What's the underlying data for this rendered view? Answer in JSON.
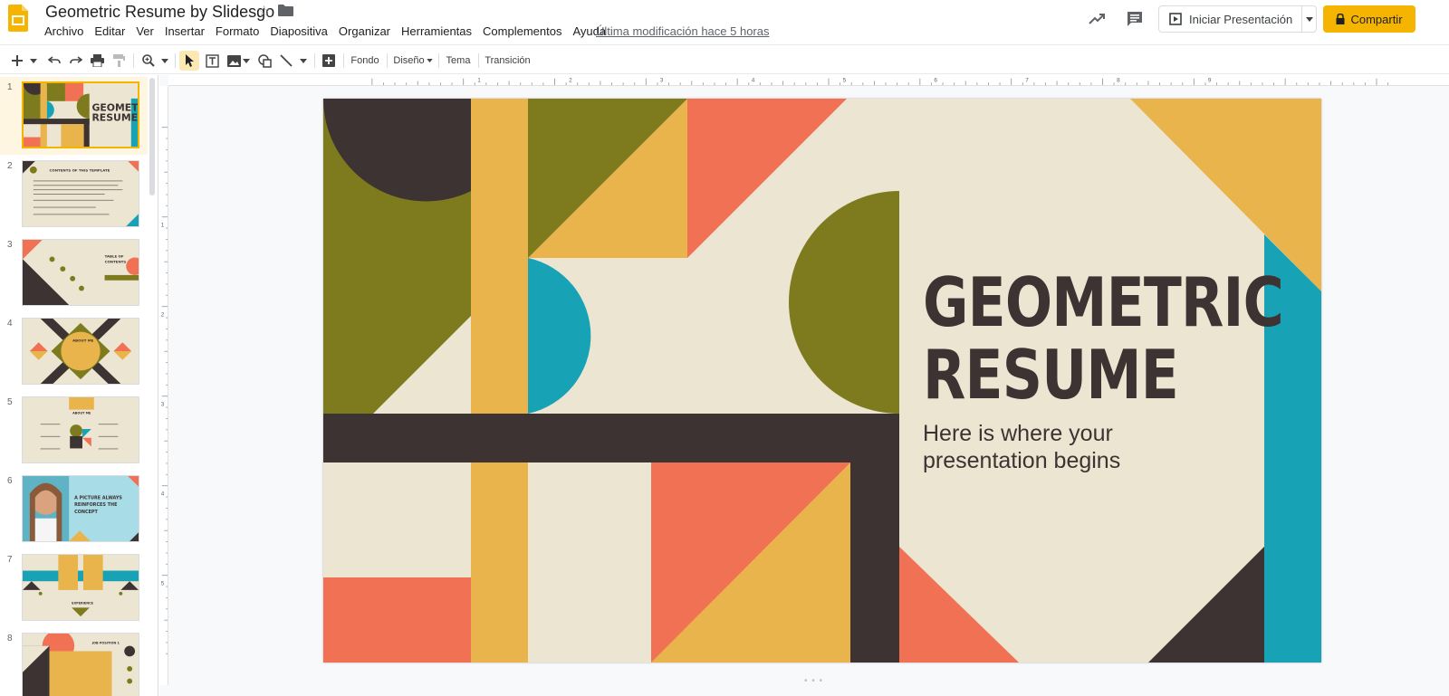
{
  "header": {
    "doc_title": "Geometric Resume by Slidesgo",
    "last_edit": "Última modificación hace 5 horas",
    "present_label": "Iniciar Presentación",
    "share_label": "Compartir"
  },
  "menu": [
    "Archivo",
    "Editar",
    "Ver",
    "Insertar",
    "Formato",
    "Diapositiva",
    "Organizar",
    "Herramientas",
    "Complementos",
    "Ayuda"
  ],
  "toolbar": {
    "fondo": "Fondo",
    "diseno": "Diseño",
    "tema": "Tema",
    "transicion": "Transición"
  },
  "filmstrip": {
    "slides": [
      {
        "num": "1",
        "title": "GEOMETRIC RESUME"
      },
      {
        "num": "2",
        "title": "CONTENTS OF THIS TEMPLATE"
      },
      {
        "num": "3",
        "title": "TABLE OF CONTENTS"
      },
      {
        "num": "4",
        "title": "ABOUT ME"
      },
      {
        "num": "5",
        "title": "ABOUT ME"
      },
      {
        "num": "6",
        "title": "A PICTURE ALWAYS REINFORCES THE CONCEPT"
      },
      {
        "num": "7",
        "title": "EXPERIENCE"
      },
      {
        "num": "8",
        "title": "JOB POSITION 1"
      }
    ],
    "selected": 1
  },
  "ruler": {
    "h_labels": [
      "1",
      "2",
      "3",
      "4",
      "5",
      "6",
      "7",
      "8",
      "9"
    ],
    "v_labels": [
      "1",
      "2",
      "3",
      "4",
      "5"
    ]
  },
  "slide": {
    "title_line1": "GEOMETRIC",
    "title_line2": "RESUME",
    "subtitle": "Here is where your presentation begins"
  },
  "colors": {
    "cream": "#ebe5d1",
    "olive": "#7e7b1f",
    "dark": "#3d3332",
    "mustard": "#e9b44c",
    "coral": "#f17155",
    "teal": "#17a3b5",
    "accent": "#f4b400"
  }
}
